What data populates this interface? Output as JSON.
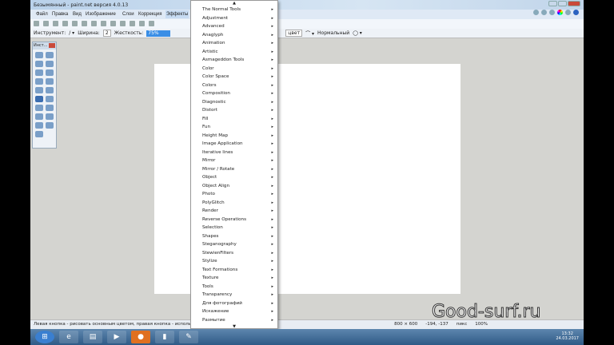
{
  "title": "Безымянный - paint.net версия 4.0.13",
  "menubar": [
    "Файл",
    "Правка",
    "Вид",
    "Изображение",
    "Слои",
    "Коррекция",
    "Эффекты"
  ],
  "options": {
    "tool_label": "Инструмент:",
    "width_label": "Ширина:",
    "width_value": "2",
    "hardness_label": "Жесткость:",
    "hardness_value": "75%",
    "fill_value": "цвет",
    "blend_mode": "Нормальный"
  },
  "tools_title": "Инст...",
  "effects_menu": [
    "The Normal Tools",
    "Adjustment",
    "Advanced",
    "Anaglyph",
    "Animation",
    "Artistic",
    "Asmageddon Tools",
    "Color",
    "Color Space",
    "Colors",
    "Composition",
    "Diagnostic",
    "Distort",
    "Fill",
    "Fun",
    "Height Map",
    "Image Application",
    "Iterative lines",
    "Mirror",
    "Mirror / Rotate",
    "Object",
    "Object Align",
    "Photo",
    "PolyGlitch",
    "Render",
    "Reverse Operations",
    "Selection",
    "Shapes",
    "Steganography",
    "StewienFilters",
    "Stylize",
    "Text Formations",
    "Texture",
    "Tools",
    "Transparency",
    "Для фотографий",
    "Искажение",
    "Размытие"
  ],
  "status": {
    "hint": "Левая кнопка - рисовать основным цветом, правая кнопка - использов...",
    "size": "800 × 600",
    "coords": "-194, -137",
    "unit": "пикс",
    "zoom": "100%"
  },
  "clock": {
    "time": "13:32",
    "date": "24.03.2017"
  },
  "watermark": "Good-surf.ru"
}
